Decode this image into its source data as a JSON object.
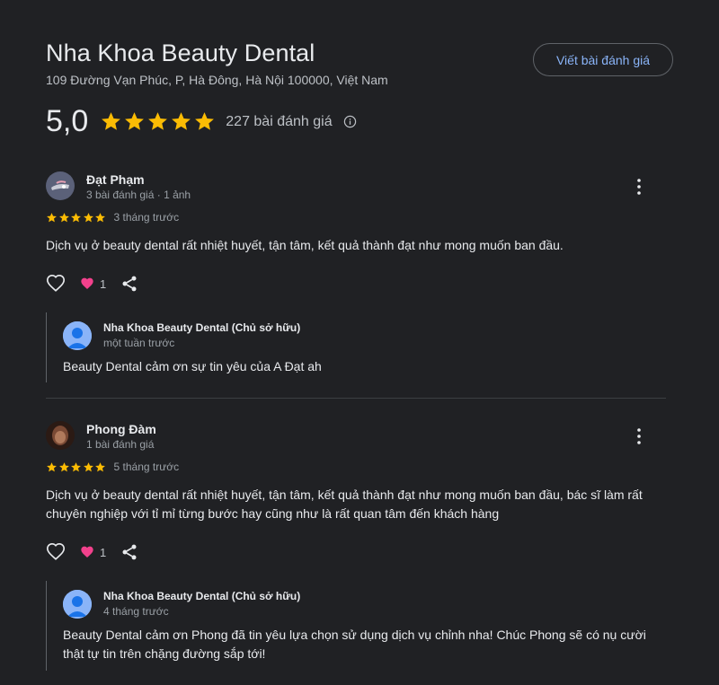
{
  "business": {
    "name": "Nha Khoa Beauty Dental",
    "address": "109 Đường Vạn Phúc, P, Hà Đông, Hà Nội 100000, Việt Nam",
    "write_review_label": "Viết bài đánh giá",
    "rating": "5,0",
    "stars": 5,
    "review_count_label": "227 bài đánh giá"
  },
  "colors": {
    "star": "#fbbc04",
    "accent": "#8ab4f8",
    "heart": "#f2418c"
  },
  "reviews": [
    {
      "name": "Đạt Phạm",
      "meta": "3 bài đánh giá · 1 ảnh",
      "stars": 5,
      "date": "3 tháng trước",
      "text": "Dịch vụ ở beauty dental rất nhiệt huyết, tận tâm, kết quả thành đạt như mong muốn ban đầu.",
      "reaction_count": "1",
      "owner_reply": {
        "name": "Nha Khoa Beauty Dental (Chủ sở hữu)",
        "time": "một tuần trước",
        "text": "Beauty Dental cảm ơn sự tin yêu của A Đạt ah"
      }
    },
    {
      "name": "Phong Đàm",
      "meta": "1 bài đánh giá",
      "stars": 5,
      "date": "5 tháng trước",
      "text": "Dịch vụ ở beauty dental rất nhiệt huyết, tận tâm, kết quả thành đạt như mong muốn ban đầu, bác sĩ làm rất chuyên nghiệp với tỉ mỉ từng bước hay cũng như là rất quan tâm đến khách hàng",
      "reaction_count": "1",
      "owner_reply": {
        "name": "Nha Khoa Beauty Dental (Chủ sở hữu)",
        "time": "4 tháng trước",
        "text": "Beauty Dental cảm ơn Phong đã tin yêu lựa chọn sử dụng dịch vụ chỉnh nha! Chúc Phong sẽ có nụ cười thật tự tin trên chặng đường sắp tới!"
      }
    }
  ]
}
